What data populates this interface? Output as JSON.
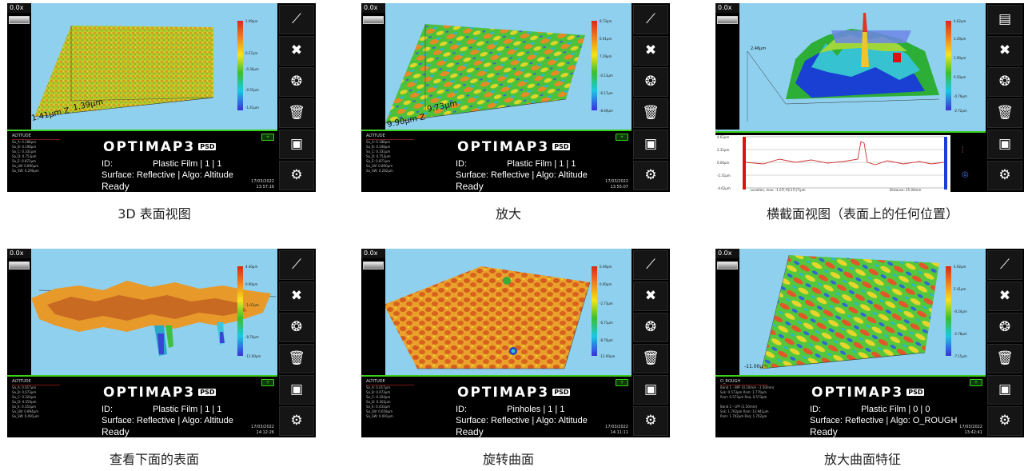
{
  "panels": [
    {
      "zoom": "0.0x",
      "caption": "3D 表面视图",
      "brand": "OPTIMAP3",
      "badge": "PSD",
      "id_label": "ID:",
      "id_value": "Plastic Film | 1 | 1",
      "surface": "Surface: Reflective | Algo: Altitude",
      "status": "Ready",
      "date": "17/03/2022",
      "time": "13:57:16",
      "stats_title": "ALTITUDE",
      "stats": [
        "Sa_A: 0.188µm",
        "Sa_B: 0.198µm",
        "Sa_C: 0.331µm",
        "Sa_D: 0.753µm",
        "Sa_E: 0.871µm",
        "Sa_LW: 0.890µm",
        "Sa_SW: 0.290µm"
      ],
      "scale_ticks": [
        "1.09µm",
        "0.27µm",
        "-0.30µm",
        "-0.55µm",
        "-1.41µm"
      ],
      "axis_label": "1.41µm Z",
      "axis_label2": "1.39µm",
      "icons": [
        "chart-icon",
        "tools-icon",
        "shutter-icon",
        "trash-icon",
        "save-icon",
        "gear-icon"
      ]
    },
    {
      "zoom": "0.0x",
      "caption": "放大",
      "brand": "OPTIMAP3",
      "badge": "PSD",
      "id_label": "ID:",
      "id_value": "Plastic Film | 1 | 1",
      "surface": "Surface: Reflective | Algo: Altitude",
      "status": "Ready",
      "date": "17/03/2022",
      "time": "13:55:07",
      "stats_title": "ALTITUDE",
      "stats": [
        "Sa_A: 0.188µm",
        "Sa_B: 0.198µm",
        "Sa_C: 0.331µm",
        "Sa_D: 0.753µm",
        "Sa_E: 0.871µm",
        "Sa_LW: 0.890µm",
        "Sa_SW: 0.282µm"
      ],
      "scale_ticks": [
        "8.73µm",
        "6.01µm",
        "7.29µm",
        "-0.13µm",
        "-6.17µm",
        "-8.49µm"
      ],
      "axis_label": "9.90µm Z",
      "axis_label2": "9.73µm",
      "icons": [
        "chart-icon",
        "tools-icon",
        "shutter-icon",
        "trash-icon",
        "save-icon",
        "gear-icon"
      ]
    },
    {
      "zoom": "0.0x",
      "caption": "横截面视图（表面上的任何位置）",
      "scale_ticks": [
        "4.62µm",
        "3.29µm",
        "1.90µm",
        "0.50µm",
        "-0.79µm",
        "-2.72µm"
      ],
      "profile_ticks": [
        "4.62µm",
        "2.31µm",
        "0.00µm",
        "-2.31µm",
        "-4.62µm"
      ],
      "profile_footer_left": "Location, max: -1.07(-9)(17)(7)µm",
      "profile_footer_right": "Distance: 25.04mm",
      "axis_label": "2.46µm",
      "icons": [
        "list-icon",
        "tools-icon",
        "shutter-icon",
        "trash-icon",
        "save-icon",
        "gear-icon"
      ]
    },
    {
      "zoom": "0.0x",
      "caption": "查看下面的表面",
      "brand": "OPTIMAP3",
      "badge": "PSD",
      "id_label": "ID:",
      "id_value": "Plastic Film | 1 | 1",
      "surface": "Surface: Reflective | Algo: Altitude",
      "status": "Ready",
      "date": "17/03/2022",
      "time": "14:12:26",
      "stats_title": "ALTITUDE",
      "stats": [
        "Sa_A: 0.017µm",
        "Sa_B: 0.073µm",
        "Sa_C: 0.324µm",
        "Sa_D: 0.550µm",
        "Sa_E: 0.353µm",
        "Sa_LW: 0.894µm",
        "Sa_SW: 0.091µm"
      ],
      "scale_ticks": [
        "4.40µm",
        "0.90µm",
        "-1.07µm",
        "-8.70µm",
        "-11.00µm"
      ],
      "icons": [
        "chart-icon",
        "tools-icon",
        "shutter-icon",
        "trash-icon",
        "save-icon",
        "gear-icon"
      ]
    },
    {
      "zoom": "0.0x",
      "caption": "旋转曲面",
      "brand": "OPTIMAP3",
      "badge": "PSD",
      "id_label": "ID:",
      "id_value": "Pinholes | 1 | 1",
      "surface": "Surface: Reflective | Algo: Altitude",
      "status": "Ready",
      "date": "17/03/2022",
      "time": "14:11:11",
      "stats_title": "ALTITUDE",
      "stats": [
        "Sa_A: 0.017µm",
        "Sa_B: 0.073µm",
        "Sa_C: 0.324µm",
        "Sa_D: 0.302µm",
        "Sa_E: 0.433µm",
        "Sa_LW: 0.658µm",
        "Sa_SW: 0.091µm"
      ],
      "scale_ticks": [
        "0.49µm",
        "0.60µm",
        "-2.73µm",
        "-6.71µm",
        "-8.70µm",
        "-11.00µm"
      ],
      "icons": [
        "chart-icon",
        "tools-icon",
        "shutter-icon",
        "trash-icon",
        "save-icon",
        "gear-icon"
      ]
    },
    {
      "zoom": "0.0x",
      "caption": "放大曲面特征",
      "brand": "OPTIMAP3",
      "badge": "PSD",
      "id_label": "ID:",
      "id_value": "Plastic Film | 0 | 0",
      "surface": "Surface: Reflective | Algo: O_ROUGH",
      "status": "Ready",
      "date": "17/03/2022",
      "time": "13:42:41",
      "stats_title": "O_ROUGH",
      "stats": [
        "Band 1 - BPF (0.10mm - 2.50mm)",
        "Ssk: 0.573µm  Rsm: 1.770µm",
        "Rsm: 0.573µm  Rsq: 0.573µm",
        "",
        "Band 2 - LPF (2.50mm)",
        "Ssk: 1.702µm  Rsm: 13.941µm",
        "Rsm: 1.702µm  Rsq: 1.702µm"
      ],
      "scale_ticks": [
        "4.92µm",
        "2.41µm",
        "-0.24µm",
        "-2.78µm",
        "-7.15µm"
      ],
      "axis_label": "-11.00µm",
      "icons": [
        "chart-icon",
        "tools-icon",
        "shutter-icon",
        "trash-icon",
        "save-icon",
        "gear-icon"
      ]
    }
  ],
  "icon_glyphs": {
    "chart-icon": "⟋",
    "tools-icon": "✖",
    "shutter-icon": "❂",
    "trash-icon": "🗑",
    "save-icon": "▣",
    "gear-icon": "⚙",
    "list-icon": "▤",
    "profile-icon": "⫶",
    "loop-icon": "◎"
  }
}
